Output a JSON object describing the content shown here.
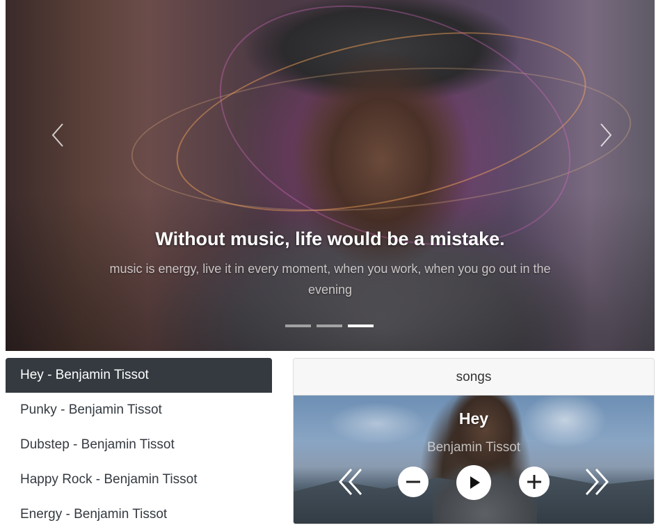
{
  "carousel": {
    "title": "Without music, life would be a mistake.",
    "subtitle": "music is energy, live it in every moment, when you work, when you go out in the evening",
    "slide_count": 3,
    "active_slide": 3,
    "prev_icon": "chevron-left-icon",
    "next_icon": "chevron-right-icon"
  },
  "playlist": {
    "items": [
      {
        "label": "Hey - Benjamin Tissot",
        "active": true
      },
      {
        "label": "Punky - Benjamin Tissot",
        "active": false
      },
      {
        "label": "Dubstep - Benjamin Tissot",
        "active": false
      },
      {
        "label": "Happy Rock - Benjamin Tissot",
        "active": false
      },
      {
        "label": "Energy - Benjamin Tissot",
        "active": false
      }
    ],
    "active_color": "#343a40"
  },
  "player": {
    "header": "songs",
    "track_title": "Hey",
    "track_artist": "Benjamin Tissot",
    "controls": {
      "prev": "double-chevron-left-icon",
      "volume_down": "minus-icon",
      "play": "play-icon",
      "volume_up": "plus-icon",
      "next": "double-chevron-right-icon"
    }
  }
}
